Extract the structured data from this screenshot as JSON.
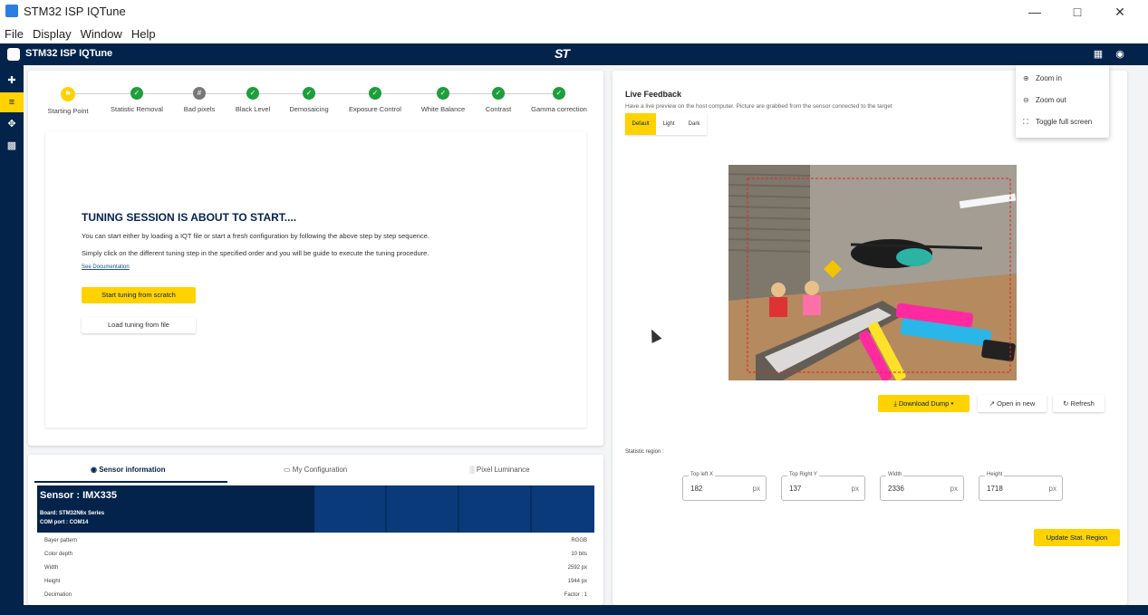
{
  "window": {
    "title": "STM32 ISP IQTune",
    "controls": {
      "minimize": "—",
      "maximize": "□",
      "close": "✕"
    }
  },
  "menubar": [
    "File",
    "Display",
    "Window",
    "Help"
  ],
  "app_header": {
    "title": "STM32 ISP IQTune",
    "brand": "ST",
    "icons": [
      "memory-icon",
      "globe-icon"
    ]
  },
  "rail": {
    "icons": [
      "usb-icon",
      "tune-icon",
      "move-icon",
      "document-icon"
    ],
    "active_index": 1
  },
  "stepper": [
    {
      "label": "Starting Point",
      "state": "current"
    },
    {
      "label": "Statistic Removal",
      "state": "done"
    },
    {
      "label": "Bad pixels",
      "state": "gray"
    },
    {
      "label": "Black Level",
      "state": "done"
    },
    {
      "label": "Demosaicing",
      "state": "done"
    },
    {
      "label": "Exposure Control",
      "state": "done"
    },
    {
      "label": "White Balance",
      "state": "done"
    },
    {
      "label": "Contrast",
      "state": "done"
    },
    {
      "label": "Gamma correction",
      "state": "done"
    }
  ],
  "intro": {
    "title": "TUNING SESSION IS ABOUT TO START....",
    "line1": "You can start either by loading a IQT file or start a fresh configuration by following the above step by step sequence.",
    "line2": "Simply click on the different tuning step in the specified order and you will be guide to execute the tuning procedure.",
    "link": "See Documentation",
    "btn_start": "Start tuning from scratch",
    "btn_load": "Load tuning from file"
  },
  "sensor_tabs": [
    {
      "label": "Sensor information",
      "icon": "globe-icon"
    },
    {
      "label": "My Configuration",
      "icon": "monitor-icon"
    },
    {
      "label": "Pixel Luminance",
      "icon": "bar-chart-icon"
    }
  ],
  "sensor": {
    "name": "Sensor : IMX335",
    "board": "Board: STM32N6x Series",
    "com": "COM port : COM14",
    "rows": [
      {
        "k": "Bayer pattern",
        "v": "RGGB"
      },
      {
        "k": "Color depth",
        "v": "10 bits"
      },
      {
        "k": "Width",
        "v": "2592 px"
      },
      {
        "k": "Height",
        "v": "1944 px"
      },
      {
        "k": "Decimation",
        "v": "Factor : 1"
      }
    ]
  },
  "live_feedback": {
    "title": "Live Feedback",
    "subtitle": "Have a live preview on the host computer. Picture are grabbed from the sensor connected to the target",
    "themes": [
      "Default",
      "Light",
      "Dark"
    ],
    "active_theme": "Default",
    "zoom_menu": [
      {
        "label": "Zoom in",
        "icon": "zoom-in-icon"
      },
      {
        "label": "Zoom out",
        "icon": "zoom-out-icon"
      },
      {
        "label": "Toggle full screen",
        "icon": "fullscreen-icon"
      }
    ],
    "btn_download": "Download Dump",
    "btn_open": "Open in new",
    "btn_refresh": "Refresh"
  },
  "stat_region": {
    "label": "Statistic region :",
    "fields": [
      {
        "label": "Top left X",
        "value": "182",
        "unit": "px"
      },
      {
        "label": "Top Right Y",
        "value": "137",
        "unit": "px"
      },
      {
        "label": "Width",
        "value": "2336",
        "unit": "px"
      },
      {
        "label": "Height",
        "value": "1718",
        "unit": "px"
      }
    ],
    "btn_update": "Update Stat. Region"
  },
  "colors": {
    "navy": "#03234b",
    "yellow": "#ffd200",
    "green": "#1e9e3c"
  }
}
